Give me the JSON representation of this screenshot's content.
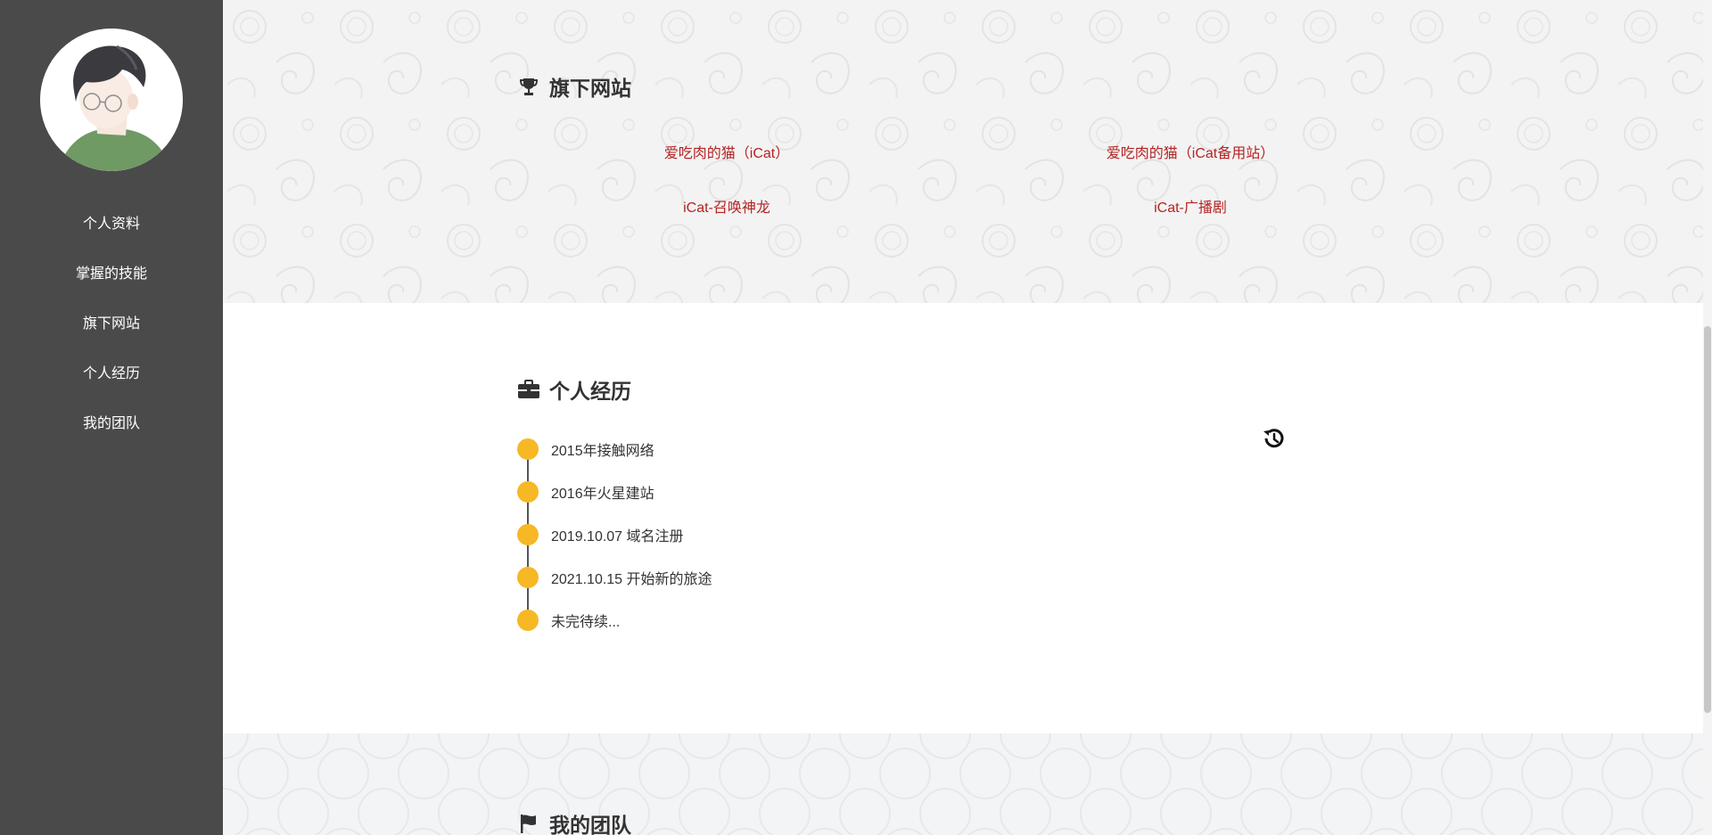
{
  "sidebar": {
    "nav": [
      {
        "label": "个人资料"
      },
      {
        "label": "掌握的技能"
      },
      {
        "label": "旗下网站"
      },
      {
        "label": "个人经历"
      },
      {
        "label": "我的团队"
      }
    ],
    "colors": {
      "background": "#4a4a4a",
      "text": "#ffffff"
    }
  },
  "sites_section": {
    "title": "旗下网站",
    "icon": "trophy-icon",
    "links": [
      {
        "label": "爱吃肉的猫（iCat）"
      },
      {
        "label": "爱吃肉的猫（iCat备用站）"
      },
      {
        "label": "iCat-召唤神龙"
      },
      {
        "label": "iCat-广播剧"
      }
    ],
    "link_color": "#b52323"
  },
  "experience_section": {
    "title": "个人经历",
    "icon": "briefcase-icon",
    "timeline": [
      {
        "text": "2015年接触网络"
      },
      {
        "text": "2016年火星建站"
      },
      {
        "text": "2019.10.07 域名注册"
      },
      {
        "text": "2021.10.15 开始新的旅途"
      },
      {
        "text": "未完待续..."
      }
    ],
    "dot_color": "#f6b824",
    "side_icon": "history-icon"
  },
  "team_section": {
    "title": "我的团队",
    "icon": "flag-icon"
  }
}
